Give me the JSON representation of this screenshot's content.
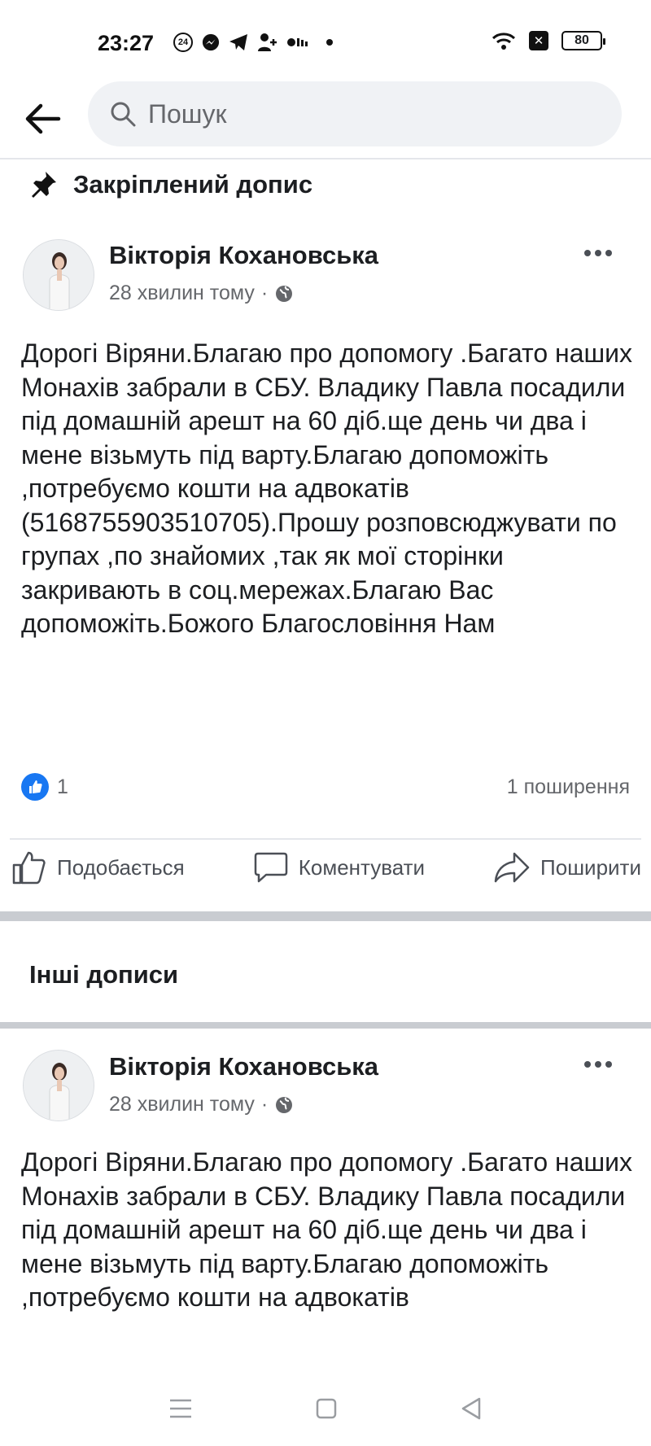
{
  "status_bar": {
    "time": "23:27",
    "notification_badge": "24",
    "battery": "80",
    "icons": [
      "badge-24-icon",
      "messenger-icon",
      "telegram-icon",
      "user-plus-icon",
      "signal-icon",
      "dot-icon",
      "wifi-icon",
      "notification-x-icon",
      "battery-icon"
    ]
  },
  "header": {
    "search_placeholder": "Пошук"
  },
  "pinned": {
    "label": "Закріплений допис"
  },
  "posts": [
    {
      "author": "Вікторія Кохановська",
      "time": "28 хвилин тому",
      "text": "Дорогі Віряни.Благаю про допомогу .Багато наших Монахів забрали в СБУ. Владику Павла посадили під домашній арешт на 60 діб.ще день чи два і мене візьмуть  під варту.Благаю допоможіть ,потребуємо кошти на адвокатів (5168755903510705).Прошу розповсюджувати по групах ,по знайомих ,так як мої сторінки закривають в соц.мережах.Благаю Вас допоможіть.Божого Благословіння Нам",
      "likes": "1",
      "shares": "1 поширення",
      "actions": {
        "like": "Подобається",
        "comment": "Коментувати",
        "share": "Поширити"
      }
    },
    {
      "author": "Вікторія Кохановська",
      "time": "28 хвилин тому",
      "text": "Дорогі Віряни.Благаю про допомогу .Багато наших Монахів забрали в СБУ. Владику Павла посадили під домашній арешт на 60 діб.ще день чи два і мене візьмуть  під варту.Благаю допоможіть ,потребуємо кошти на адвокатів"
    }
  ],
  "other_posts": {
    "title": "Інші дописи"
  },
  "colors": {
    "like_blue": "#1877f2",
    "search_bg": "#f0f2f5",
    "secondary_text": "#65676b",
    "divider": "#c9ccd1"
  }
}
